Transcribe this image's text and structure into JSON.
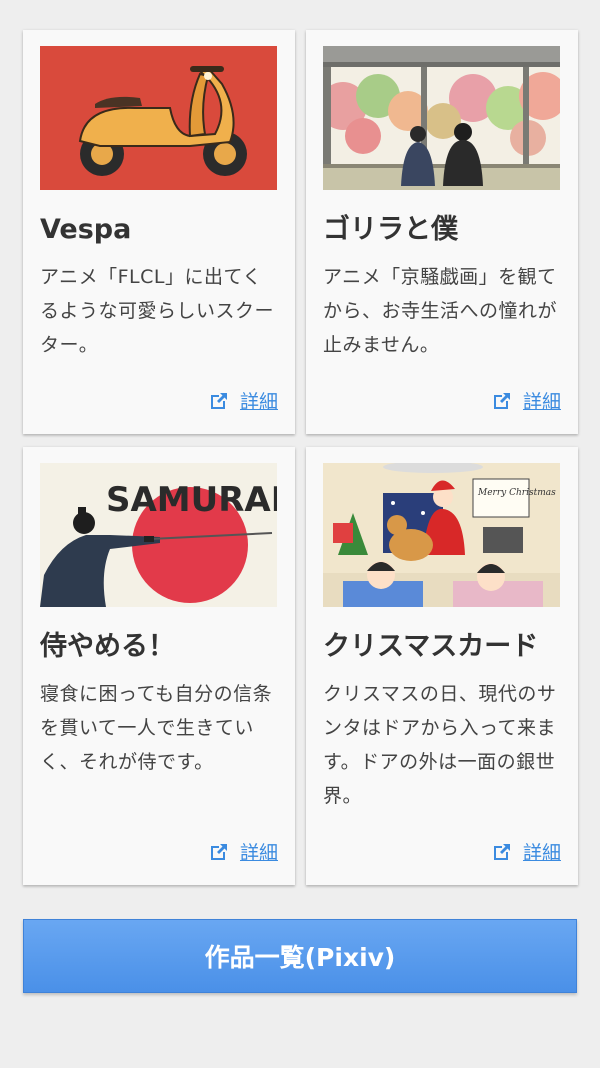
{
  "cards": [
    {
      "title": "Vespa",
      "description": "アニメ「FLCL」に出てくるような可愛らしいスクーター。",
      "detail_label": "詳細",
      "thumbnail": "orange-scooter-illustration",
      "thumb_bg": "#d94a3c"
    },
    {
      "title": "ゴリラと僕",
      "description": "アニメ「京騒戯画」を観てから、お寺生活への憧れが止みません。",
      "detail_label": "詳細",
      "thumbnail": "gorilla-and-boy-temple-illustration"
    },
    {
      "title": "侍やめる！",
      "description": "寝食に困っても自分の信条を貫いて一人で生きていく、それが侍です。",
      "detail_label": "詳細",
      "thumbnail": "samurai-red-sun-illustration",
      "thumb_text": "SAMURAI"
    },
    {
      "title": "クリスマスカード",
      "description": "クリスマスの日、現代のサンタはドアから入って来ます。ドアの外は一面の銀世界。",
      "detail_label": "詳細",
      "thumbnail": "christmas-card-illustration",
      "thumb_text": "Merry Christmas"
    }
  ],
  "pixiv_button": {
    "label": "作品一覧(Pixiv)"
  },
  "colors": {
    "link": "#3b8be0",
    "button": "#5a9cee",
    "background": "#eeeeee"
  },
  "icons": {
    "detail": "external-link-icon"
  }
}
